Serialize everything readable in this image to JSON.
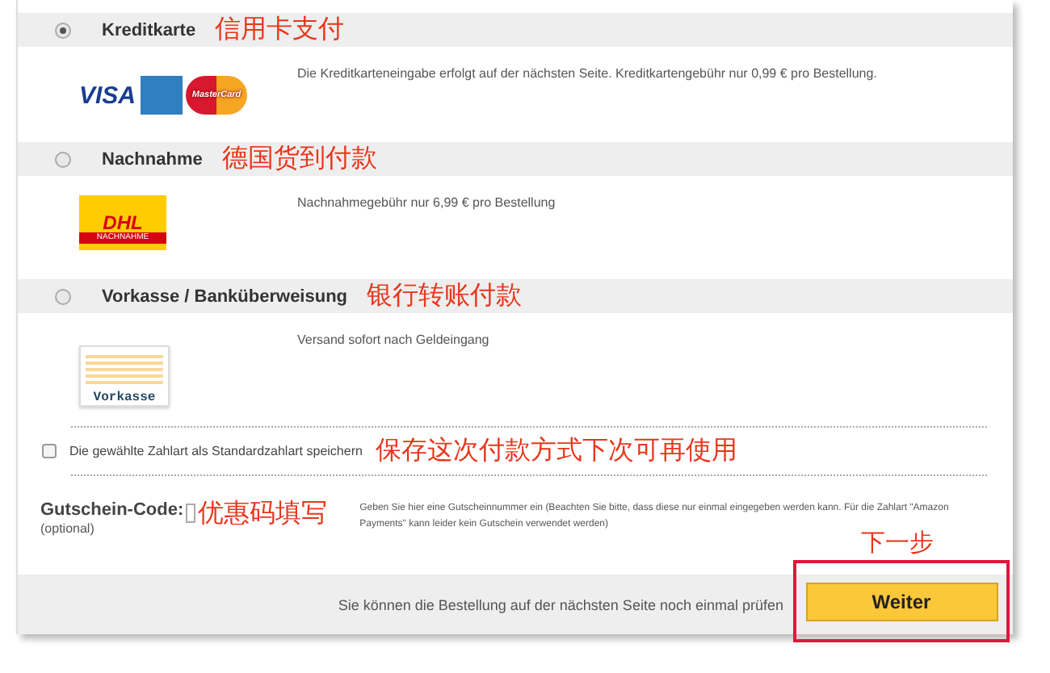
{
  "payment_methods": [
    {
      "kind": "card",
      "selected": true,
      "title": "Kreditkarte",
      "annotation": "信用卡支付",
      "logos": [
        "VISA",
        "MasterCard"
      ],
      "note": "Die Kreditkarteneingabe erfolgt auf der nächsten Seite. Kreditkartengebühr nur 0,99 € pro Bestellung."
    },
    {
      "kind": "dhl",
      "selected": false,
      "title": "Nachnahme",
      "annotation": "德国货到付款",
      "logos": [
        "DHL",
        "NACHNAHME"
      ],
      "note": "Nachnahmegebühr nur 6,99 € pro Bestellung"
    },
    {
      "kind": "transfer",
      "selected": false,
      "title": "Vorkasse / Banküberweisung",
      "annotation": "银行转账付款",
      "logos": [
        "Vorkasse"
      ],
      "note": "Versand sofort nach Geldeingang"
    }
  ],
  "save_default": {
    "checked": false,
    "label": "Die gewählte Zahlart als Standardzahlart speichern",
    "annotation": "保存这次付款方式下次可再使用"
  },
  "voucher": {
    "label": "Gutschein-Code:",
    "sublabel": "(optional)",
    "annotation": "优惠码填写",
    "hint": "Geben Sie hier eine Gutscheinnummer ein (Beachten Sie bitte, dass diese nur einmal eingegeben werden kann. Für die Zahlart \"Amazon Payments\" kann leider kein Gutschein verwendet werden)"
  },
  "footer": {
    "note": "Sie können die Bestellung auf der nächsten Seite noch einmal prüfen",
    "button": "Weiter",
    "annotation": "下一步"
  }
}
